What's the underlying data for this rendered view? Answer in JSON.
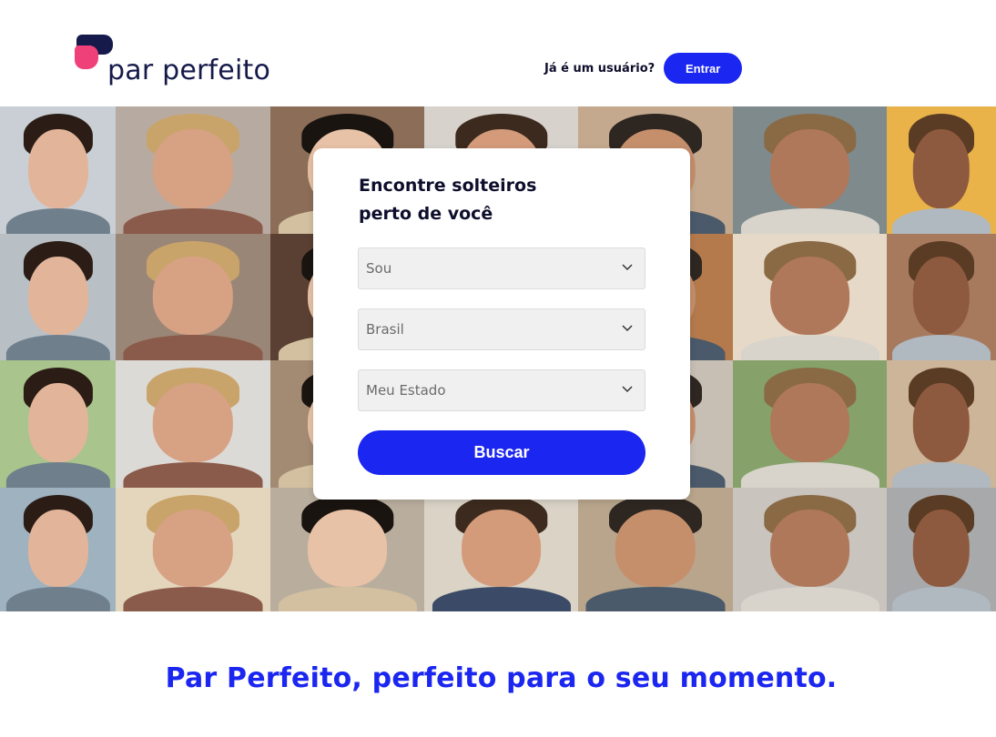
{
  "header": {
    "logo_text": "par perfeito",
    "existing_user_text": "Já é um usuário?",
    "login_label": "Entrar"
  },
  "search_card": {
    "title_line1": "Encontre solteiros",
    "title_line2": "perto de você",
    "gender_select": "Sou",
    "country_select": "Brasil",
    "state_select": "Meu Estado",
    "search_label": "Buscar"
  },
  "tagline": "Par Perfeito, perfeito para o seu momento.",
  "colors": {
    "brand_blue": "#1b26f0",
    "logo_navy": "#161a4a",
    "logo_pink": "#f0407a"
  },
  "icons": {
    "select_chevron": "chevron-down-icon",
    "logo_mark": "speech-bubble-logo-icon"
  }
}
